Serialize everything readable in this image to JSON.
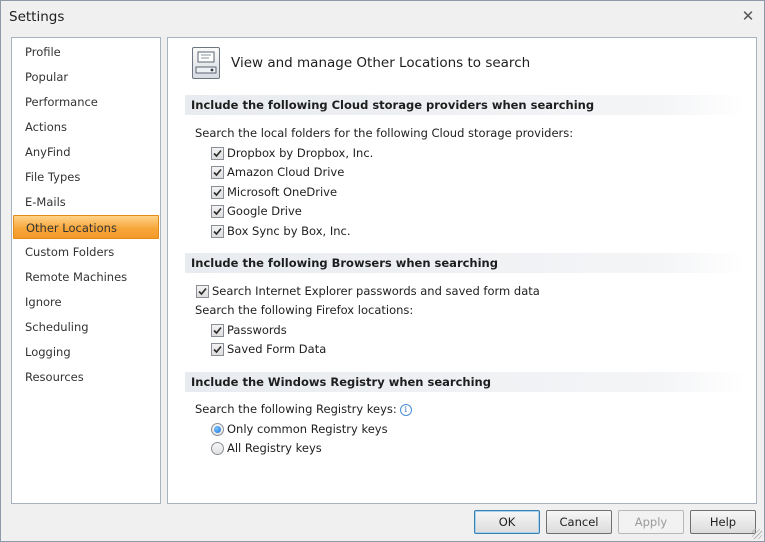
{
  "window": {
    "title": "Settings",
    "close_glyph": "✕"
  },
  "nav": {
    "items": [
      {
        "label": "Profile",
        "active": false
      },
      {
        "label": "Popular",
        "active": false
      },
      {
        "label": "Performance",
        "active": false
      },
      {
        "label": "Actions",
        "active": false
      },
      {
        "label": "AnyFind",
        "active": false
      },
      {
        "label": "File Types",
        "active": false
      },
      {
        "label": "E-Mails",
        "active": false
      },
      {
        "label": "Other Locations",
        "active": true
      },
      {
        "label": "Custom Folders",
        "active": false
      },
      {
        "label": "Remote Machines",
        "active": false
      },
      {
        "label": "Ignore",
        "active": false
      },
      {
        "label": "Scheduling",
        "active": false
      },
      {
        "label": "Logging",
        "active": false
      },
      {
        "label": "Resources",
        "active": false
      }
    ]
  },
  "content": {
    "header_title": "View and manage Other Locations to search",
    "cloud": {
      "heading": "Include the following Cloud storage providers when searching",
      "intro": "Search the local folders for the following Cloud storage providers:",
      "items": [
        {
          "label": "Dropbox by Dropbox, Inc.",
          "checked": true
        },
        {
          "label": "Amazon Cloud Drive",
          "checked": true
        },
        {
          "label": "Microsoft OneDrive",
          "checked": true
        },
        {
          "label": "Google Drive",
          "checked": true
        },
        {
          "label": "Box Sync by Box, Inc.",
          "checked": true
        }
      ]
    },
    "browsers": {
      "heading": "Include the following Browsers when searching",
      "ie_label": "Search Internet Explorer passwords and saved form data",
      "ie_checked": true,
      "firefox_intro": "Search the following Firefox locations:",
      "firefox_items": [
        {
          "label": "Passwords",
          "checked": true
        },
        {
          "label": "Saved Form Data",
          "checked": true
        }
      ]
    },
    "registry": {
      "heading": "Include the Windows Registry when searching",
      "intro": "Search the following Registry keys:",
      "info_glyph": "i",
      "options": [
        {
          "label": "Only common Registry keys",
          "selected": true
        },
        {
          "label": "All Registry keys",
          "selected": false
        }
      ]
    }
  },
  "buttons": {
    "ok": "OK",
    "cancel": "Cancel",
    "apply": "Apply",
    "help": "Help"
  }
}
